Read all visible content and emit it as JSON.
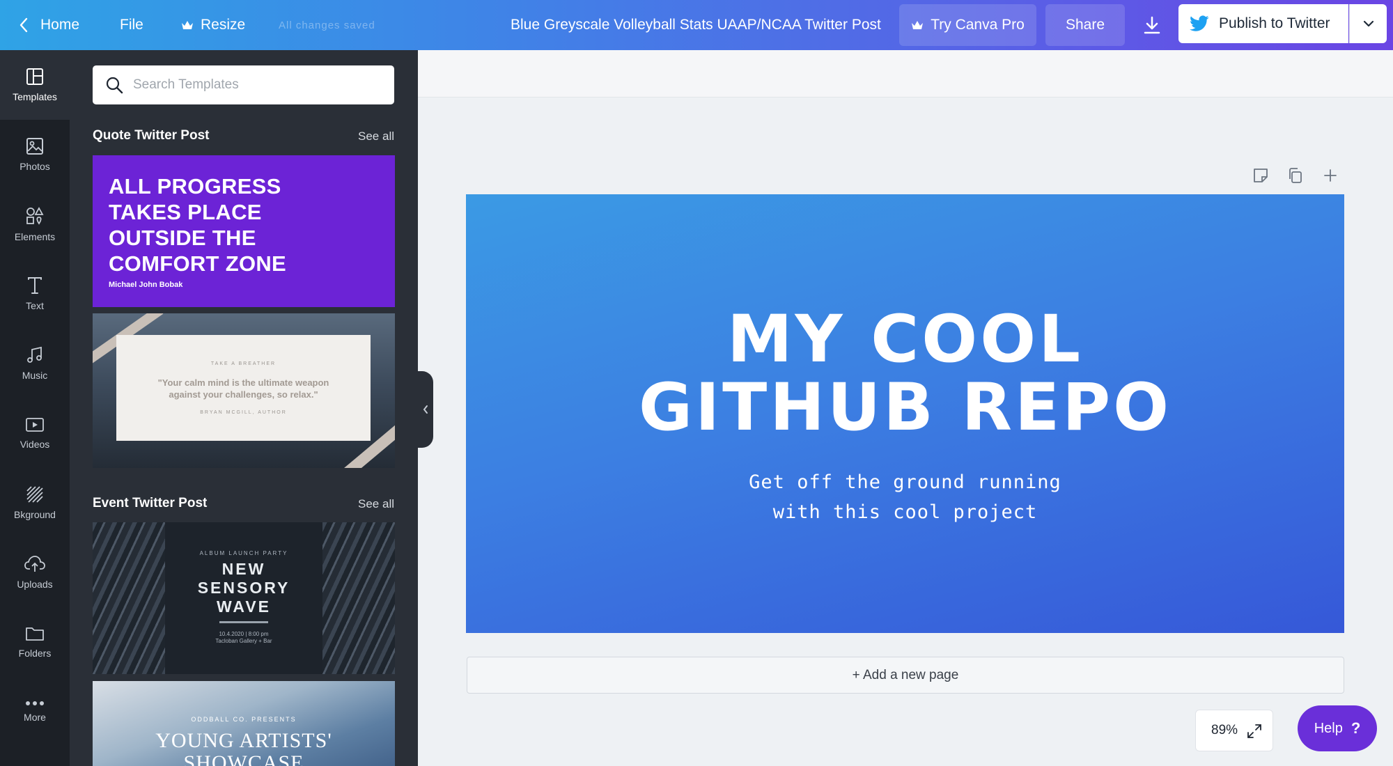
{
  "topbar": {
    "home_label": "Home",
    "file_label": "File",
    "resize_label": "Resize",
    "saved_status": "All changes saved",
    "document_title": "Blue Greyscale Volleyball Stats UAAP/NCAA Twitter Post",
    "try_pro_label": "Try Canva Pro",
    "share_label": "Share",
    "publish_label": "Publish to Twitter",
    "icons": {
      "home": "chevron-left-icon",
      "resize": "crown-icon",
      "try_pro": "crown-icon",
      "download": "download-icon",
      "publish": "twitter-bird-icon",
      "dropdown": "chevron-down-icon"
    }
  },
  "rail": {
    "items": [
      {
        "label": "Templates",
        "icon": "templates-icon",
        "active": true
      },
      {
        "label": "Photos",
        "icon": "photo-icon"
      },
      {
        "label": "Elements",
        "icon": "shapes-icon"
      },
      {
        "label": "Text",
        "icon": "text-icon"
      },
      {
        "label": "Music",
        "icon": "music-note-icon"
      },
      {
        "label": "Videos",
        "icon": "video-icon"
      },
      {
        "label": "Bkground",
        "icon": "background-icon"
      },
      {
        "label": "Uploads",
        "icon": "cloud-upload-icon"
      },
      {
        "label": "Folders",
        "icon": "folder-icon"
      },
      {
        "label": "More",
        "icon": "more-dots-icon"
      }
    ]
  },
  "panel": {
    "search": {
      "placeholder": "Search Templates",
      "value": ""
    },
    "sections": [
      {
        "title": "Quote Twitter Post",
        "see_all": "See all"
      },
      {
        "title": "Event Twitter Post",
        "see_all": "See all"
      }
    ],
    "templates": {
      "quote": {
        "text": [
          "ALL PROGRESS",
          "TAKES PLACE",
          "OUTSIDE THE",
          "COMFORT ZONE"
        ],
        "author": "Michael John Bobak",
        "color": "#6c23d6"
      },
      "calm": {
        "kicker": "TAKE A BREATHER",
        "quote": "\"Your calm mind is the ultimate weapon against your challenges, so relax.\"",
        "author": "BRYAN MCGILL, AUTHOR"
      },
      "event": {
        "kicker": "ALBUM LAUNCH PARTY",
        "title": [
          "NEW",
          "SENSORY",
          "WAVE"
        ],
        "meta": [
          "10.4.2020 | 8:00 pm",
          "Tacloban Gallery + Bar"
        ]
      },
      "artists": {
        "kicker": "ODDBALL CO. PRESENTS",
        "title": [
          "YOUNG ARTISTS'",
          "SHOWCASE"
        ]
      }
    }
  },
  "canvas": {
    "design": {
      "title_line1": "MY COOL",
      "title_line2": "GITHUB REPO",
      "subtitle_line1": "Get off the ground running",
      "subtitle_line2": "with this cool project",
      "gradient_start": "#3b9ae4",
      "gradient_end": "#3658d8"
    },
    "page_tools": [
      "note-icon",
      "duplicate-icon",
      "plus-icon"
    ],
    "add_page_label": "+ Add a new page",
    "zoom": "89%",
    "help_label": "Help",
    "help_symbol": "?"
  },
  "colors": {
    "topbar_start": "#2fa3e6",
    "topbar_end": "#6a45e4",
    "sidebar": "#1c2026",
    "panel": "#2a2f37",
    "help": "#6a2fd9"
  }
}
